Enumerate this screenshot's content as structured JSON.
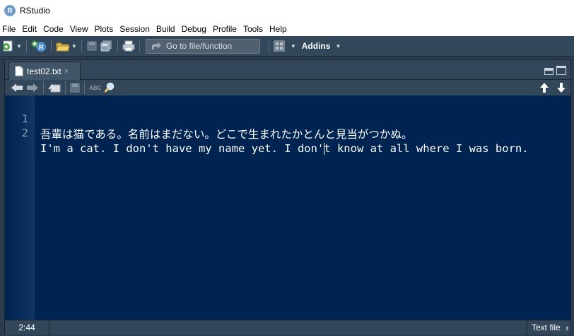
{
  "window": {
    "title": "RStudio"
  },
  "menu": [
    "File",
    "Edit",
    "Code",
    "View",
    "Plots",
    "Session",
    "Build",
    "Debug",
    "Profile",
    "Tools",
    "Help"
  ],
  "toolbar": {
    "goto_placeholder": "Go to file/function",
    "addins_label": "Addins"
  },
  "editor": {
    "tab_label": "test02.txt",
    "tab_close": "×",
    "spell_label": "ABC",
    "lines": [
      {
        "num": "1",
        "text": "吾輩は猫である。名前はまだない。どこで生まれたかとんと見当がつかぬ。"
      },
      {
        "num": "2",
        "text_before_cursor": "I'm a cat. I don't have my name yet. I don'",
        "text_after_cursor": "t know at all where I was born."
      }
    ]
  },
  "status": {
    "position": "2:44",
    "filetype": "Text file"
  },
  "colors": {
    "editor_bg": "#002451",
    "chrome_bg": "#33475b",
    "text": "#ffffff",
    "line_number": "#8c9db3"
  }
}
